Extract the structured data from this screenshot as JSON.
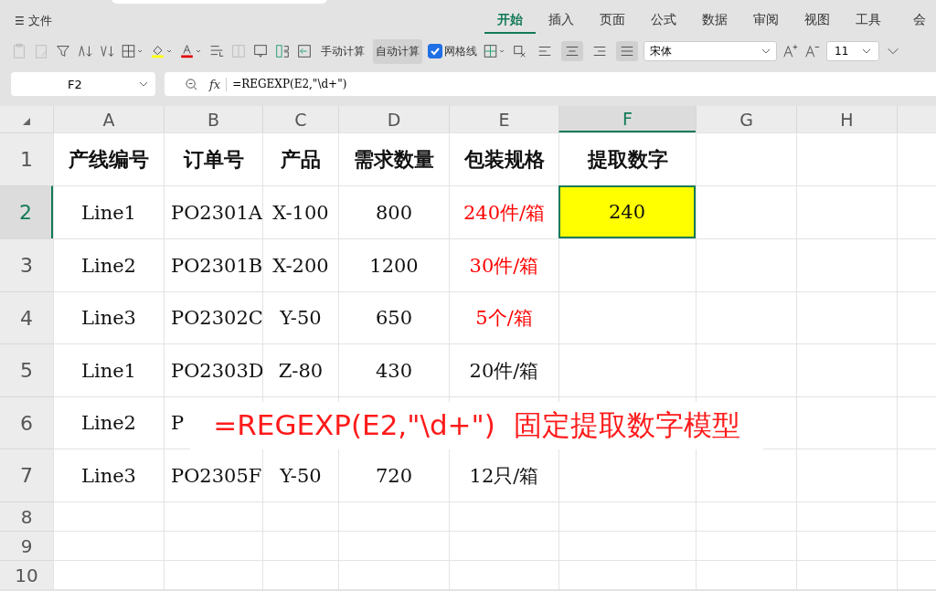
{
  "menu": {
    "label": "文件",
    "icon": "☰"
  },
  "ribbon_tabs": [
    {
      "label": "开始",
      "selected": true
    },
    {
      "label": "插入",
      "selected": false
    },
    {
      "label": "页面",
      "selected": false
    },
    {
      "label": "公式",
      "selected": false
    },
    {
      "label": "数据",
      "selected": false
    },
    {
      "label": "审阅",
      "selected": false
    },
    {
      "label": "视图",
      "selected": false
    },
    {
      "label": "工具",
      "selected": false
    },
    {
      "label": "会",
      "selected": false
    }
  ],
  "toolbar": {
    "manual_calc": {
      "label": "手动计算",
      "selected": false
    },
    "auto_calc": {
      "label": "自动计算",
      "selected": true
    },
    "gridlines": {
      "label": "网格线",
      "checked": true
    },
    "align_buttons": [
      {
        "selected": false
      },
      {
        "selected": true
      },
      {
        "selected": false
      },
      {
        "selected": true
      }
    ],
    "font": "宋体",
    "font_size": "11"
  },
  "formula_bar": {
    "cell_ref": "F2",
    "function_label": "fx",
    "formula": "=REGEXP(E2,\"\\d+\")"
  },
  "sheet": {
    "columns": [
      {
        "label": "A",
        "selected": false
      },
      {
        "label": "B",
        "selected": false
      },
      {
        "label": "C",
        "selected": false
      },
      {
        "label": "D",
        "selected": false
      },
      {
        "label": "E",
        "selected": false
      },
      {
        "label": "F",
        "selected": true
      },
      {
        "label": "G",
        "selected": false
      },
      {
        "label": "H",
        "selected": false
      }
    ],
    "rows": [
      {
        "number": "1",
        "selected": false,
        "cells": [
          {
            "text": "产线编号"
          },
          {
            "text": "订单号"
          },
          {
            "text": "产品"
          },
          {
            "text": "需求数量"
          },
          {
            "text": "包装规格"
          },
          {
            "text": "提取数字"
          }
        ]
      },
      {
        "number": "2",
        "selected": true,
        "cells": [
          {
            "text": "Line1"
          },
          {
            "text": "PO2301A"
          },
          {
            "text": "X-100"
          },
          {
            "text": "800"
          },
          {
            "text": "240件/箱",
            "color": "#ff0000"
          },
          {
            "text": "240",
            "selected": true,
            "highlighted": true
          }
        ]
      },
      {
        "number": "3",
        "selected": false,
        "cells": [
          {
            "text": "Line2"
          },
          {
            "text": "PO2301B"
          },
          {
            "text": "X-200"
          },
          {
            "text": "1200"
          },
          {
            "text": "30件/箱",
            "color": "#ff0000"
          },
          {
            "text": ""
          }
        ]
      },
      {
        "number": "4",
        "selected": false,
        "cells": [
          {
            "text": "Line3"
          },
          {
            "text": "PO2302C"
          },
          {
            "text": "Y-50"
          },
          {
            "text": "650"
          },
          {
            "text": "5个/箱",
            "color": "#ff0000"
          },
          {
            "text": ""
          }
        ]
      },
      {
        "number": "5",
        "selected": false,
        "cells": [
          {
            "text": "Line1"
          },
          {
            "text": "PO2303D"
          },
          {
            "text": "Z-80"
          },
          {
            "text": "430"
          },
          {
            "text": "20件/箱"
          },
          {
            "text": ""
          }
        ]
      },
      {
        "number": "6",
        "selected": false,
        "cells": [
          {
            "text": "Line2"
          },
          {
            "text": "P"
          },
          {
            "text": ""
          },
          {
            "text": ""
          },
          {
            "text": ""
          },
          {
            "text": ""
          }
        ]
      },
      {
        "number": "7",
        "selected": false,
        "cells": [
          {
            "text": "Line3"
          },
          {
            "text": "PO2305F"
          },
          {
            "text": "Y-50"
          },
          {
            "text": "720"
          },
          {
            "text": "12只/箱"
          },
          {
            "text": ""
          }
        ]
      },
      {
        "number": "8",
        "selected": false,
        "cells": []
      },
      {
        "number": "9",
        "selected": false,
        "cells": []
      },
      {
        "number": "10",
        "selected": false,
        "cells": []
      }
    ]
  },
  "caption": "=REGEXP(E2,\"\\d+\")  固定提取数字模型"
}
